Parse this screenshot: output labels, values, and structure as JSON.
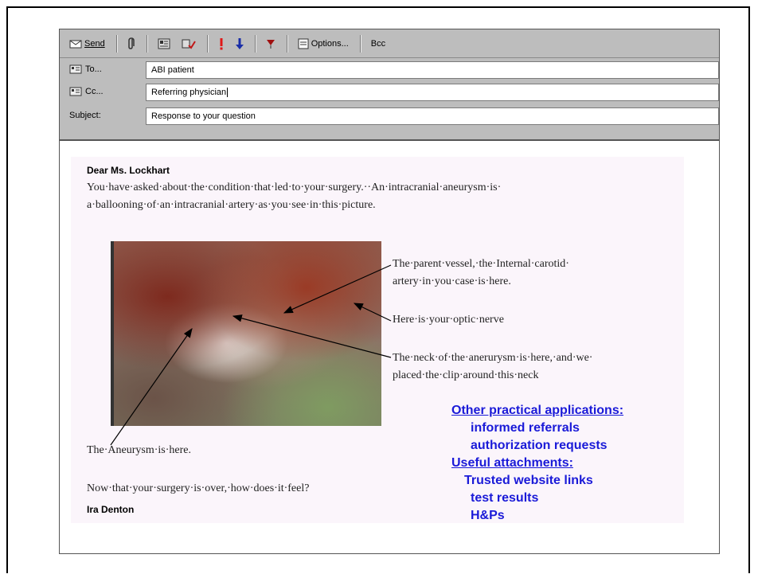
{
  "toolbar": {
    "send_label": "Send",
    "options_label": "Options...",
    "bcc_label": "Bcc",
    "icons": [
      "send-icon",
      "attach-icon",
      "address-book-icon",
      "check-names-icon",
      "high-importance-icon",
      "low-importance-icon",
      "flag-icon",
      "options-icon"
    ],
    "colors": {
      "importance_high": "#e01818",
      "importance_low": "#1a2ea8",
      "flag": "#a01010"
    }
  },
  "header": {
    "to_label": "To...",
    "to_value": "ABI patient",
    "cc_label": "Cc...",
    "cc_value": "Referring physician",
    "subject_label": "Subject:",
    "subject_value": "Response to your question"
  },
  "message": {
    "greeting": "Dear Ms. Lockhart",
    "intro_line1": "You·have·asked·about·the·condition·that·led·to·your·surgery.··An·intracranial·aneurysm·is·",
    "intro_line2": "a·ballooning·of·an·intracranial·artery·as·you·see·in·this·picture.",
    "annotation_parent_1": "The·parent·vessel,·the·Internal·carotid·",
    "annotation_parent_2": "artery·in·you·case·is·here.",
    "annotation_optic": "Here·is·your·optic·nerve",
    "annotation_neck_1": "The·neck·of·the·anerurysm·is·here,·and·we·",
    "annotation_neck_2": "placed·the·clip·around·this·neck",
    "annotation_aneurysm": "The·Aneurysm·is·here.",
    "closing_question": "Now·that·your·surgery·is·over,·how·does·it·feel?",
    "signature": "Ira Denton"
  },
  "overlay": {
    "heading1": "Other practical applications:",
    "item1": "informed referrals",
    "item2": "authorization requests",
    "heading2": "Useful  attachments:",
    "item3": "Trusted website links",
    "item4": "test results",
    "item5": "H&Ps",
    "color": "#1a1ad8"
  }
}
